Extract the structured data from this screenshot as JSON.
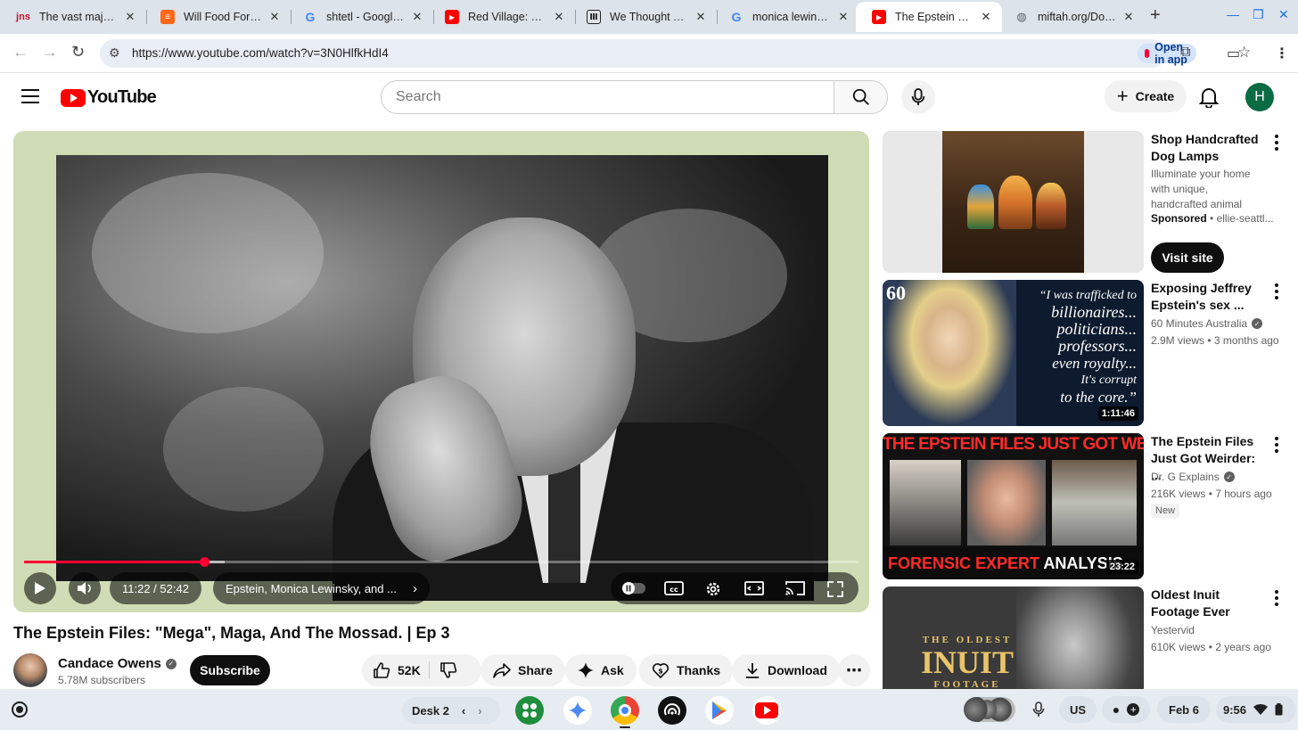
{
  "browser": {
    "tabs": [
      {
        "title": "The vast majority o",
        "favicon": "jns"
      },
      {
        "title": "Will Food Forest P",
        "favicon": "substack-icon"
      },
      {
        "title": "shtetl - Google Se",
        "favicon": "google-icon"
      },
      {
        "title": "Red Village: The L",
        "favicon": "youtube-icon"
      },
      {
        "title": "We Thought They",
        "favicon": "museum-icon"
      },
      {
        "title": "monica lewinsky M",
        "favicon": "google-icon"
      },
      {
        "title": "The Epstein Files:",
        "favicon": "youtube-icon"
      },
      {
        "title": "miftah.org/Doc/A",
        "favicon": "globe-icon"
      }
    ],
    "url": "https://www.youtube.com/watch?v=3N0HlfkHdI4",
    "open_in_app": "Open in app"
  },
  "youtube": {
    "logo_text": "YouTube",
    "search_placeholder": "Search",
    "create_label": "Create",
    "avatar_letter": "H"
  },
  "player": {
    "time": "11:22 / 52:42",
    "chapter": "Epstein, Monica Lewinsky, and ...",
    "progress_fraction": 0.2157,
    "buffered_fraction": 0.24
  },
  "video": {
    "title": "The Epstein Files: \"Mega\", Maga, And The Mossad. | Ep 3",
    "channel": "Candace Owens",
    "subscribers": "5.78M subscribers",
    "subscribe_label": "Subscribe",
    "likes": "52K",
    "share_label": "Share",
    "ask_label": "Ask",
    "thanks_label": "Thanks",
    "download_label": "Download"
  },
  "sidebar": {
    "ad": {
      "title": "Shop Handcrafted Dog Lamps",
      "description": "Illuminate your home with unique, handcrafted animal lamps. Save up ...",
      "sponsored": "Sponsored",
      "advertiser": "ellie-seattl...",
      "cta": "Visit site"
    },
    "videos": [
      {
        "title": "Exposing Jeffrey Epstein's sex ...",
        "channel": "60 Minutes Australia",
        "meta": "2.9M views • 3 months ago",
        "duration": "1:11:46",
        "thumb_lines": [
          "“I was trafficked to",
          "billionaires...",
          "politicians...",
          "professors...",
          "even royalty...",
          "It's corrupt",
          "to the core.”"
        ],
        "badge": "60"
      },
      {
        "title": "The Epstein Files Just Got Weirder: ...",
        "channel": "Dr. G Explains",
        "meta": "216K views • 7 hours ago",
        "duration": "23:22",
        "tag": "New",
        "thumb_top": "THE EPSTEIN FILES JUST GOT WEIRDER",
        "thumb_bottom_a": "FORENSIC EXPERT",
        "thumb_bottom_b": "ANALYSIS"
      },
      {
        "title": "Oldest Inuit Footage Ever",
        "channel": "Yestervid",
        "meta": "610K views • 2 years ago",
        "thumb_lines": [
          "THE OLDEST",
          "INUIT",
          "FOOTAGE"
        ]
      }
    ]
  },
  "shelf": {
    "desk": "Desk 2",
    "locale": "US",
    "date": "Feb 6",
    "time": "9:56"
  },
  "colors": {
    "youtube_red": "#ff0000",
    "progress_red": "#ff0033",
    "player_bg": "#cfdcb5"
  }
}
